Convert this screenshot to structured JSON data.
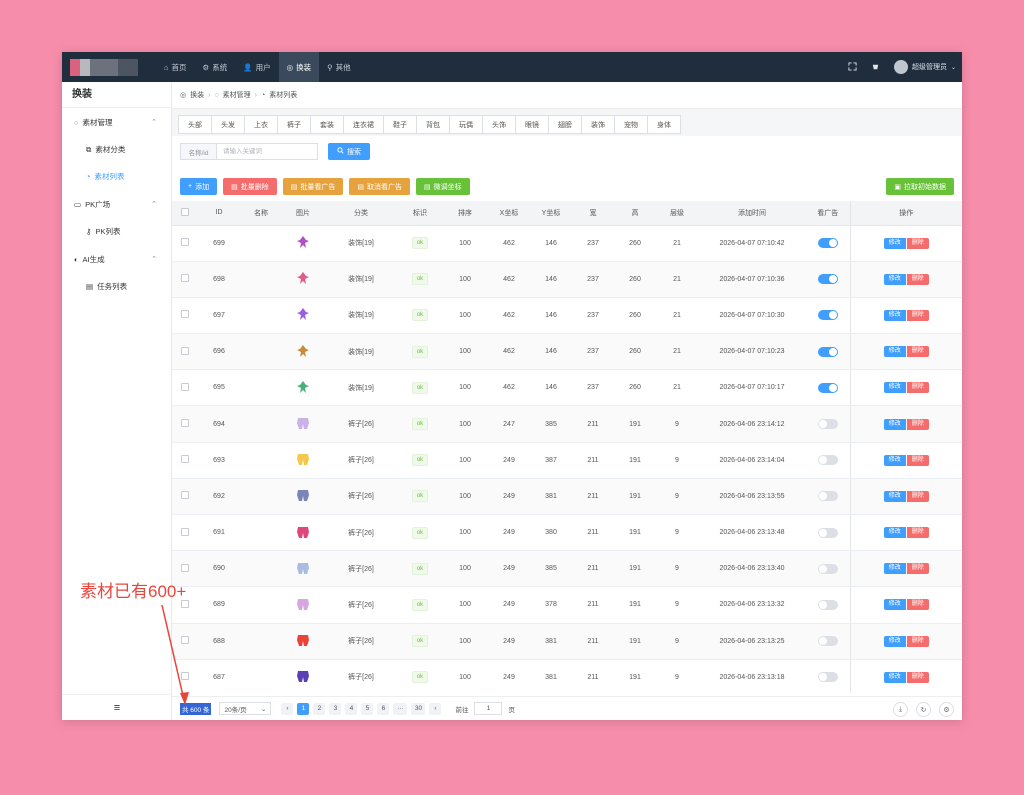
{
  "topbar": {
    "nav": [
      {
        "label": "首页",
        "icon": "home-icon"
      },
      {
        "label": "系统",
        "icon": "gear-icon"
      },
      {
        "label": "用户",
        "icon": "user-icon"
      },
      {
        "label": "换装",
        "icon": "shirt-icon",
        "active": true
      },
      {
        "label": "其他",
        "icon": "pin-icon"
      }
    ],
    "user": "超级管理员"
  },
  "sidebar": {
    "title": "换装",
    "groups": [
      {
        "label": "素材管理",
        "icon": "bulb-icon",
        "children": [
          {
            "label": "素材分类",
            "icon": "category-icon"
          },
          {
            "label": "素材列表",
            "icon": "list-icon",
            "active": true
          }
        ]
      },
      {
        "label": "PK广场",
        "icon": "chat-icon",
        "children": [
          {
            "label": "PK列表",
            "icon": "key-icon"
          }
        ]
      },
      {
        "label": "AI生成",
        "icon": "ai-icon",
        "children": [
          {
            "label": "任务列表",
            "icon": "doc-icon"
          }
        ]
      }
    ]
  },
  "breadcrumb": [
    "换装",
    "素材管理",
    "素材列表"
  ],
  "tabs": [
    "头部",
    "头发",
    "上衣",
    "裤子",
    "套装",
    "连衣裙",
    "鞋子",
    "背包",
    "玩偶",
    "头饰",
    "眼镜",
    "翅膀",
    "装饰",
    "宠物",
    "身体"
  ],
  "search": {
    "label": "名称/id",
    "placeholder": "请输入关键词",
    "button": "搜索"
  },
  "actions": {
    "add": "添加",
    "batch_delete": "批量删除",
    "batch_ad": "批量看广告",
    "cancel_ad": "取消看广告",
    "adjust": "微调坐标",
    "pull": "拉取初始数据"
  },
  "table": {
    "headers": [
      "ID",
      "名称",
      "图片",
      "分类",
      "标识",
      "排序",
      "X坐标",
      "Y坐标",
      "宽",
      "高",
      "层级",
      "添加时间",
      "看广告",
      "操作"
    ],
    "edit_label": "修改",
    "delete_label": "删除",
    "rows": [
      {
        "id": "699",
        "name": "",
        "category": "装饰[19]",
        "tag": "ok",
        "sort": "100",
        "x": "462",
        "y": "146",
        "w": "237",
        "h": "260",
        "level": "21",
        "time": "2026-04-07 07:10:42",
        "ad": true,
        "thumb_color": "#b04fc8"
      },
      {
        "id": "698",
        "name": "",
        "category": "装饰[19]",
        "tag": "ok",
        "sort": "100",
        "x": "462",
        "y": "146",
        "w": "237",
        "h": "260",
        "level": "21",
        "time": "2026-04-07 07:10:36",
        "ad": true,
        "thumb_color": "#e05a8a"
      },
      {
        "id": "697",
        "name": "",
        "category": "装饰[19]",
        "tag": "ok",
        "sort": "100",
        "x": "462",
        "y": "146",
        "w": "237",
        "h": "260",
        "level": "21",
        "time": "2026-04-07 07:10:30",
        "ad": true,
        "thumb_color": "#9b5de5"
      },
      {
        "id": "696",
        "name": "",
        "category": "装饰[19]",
        "tag": "ok",
        "sort": "100",
        "x": "462",
        "y": "146",
        "w": "237",
        "h": "260",
        "level": "21",
        "time": "2026-04-07 07:10:23",
        "ad": true,
        "thumb_color": "#c98a3a"
      },
      {
        "id": "695",
        "name": "",
        "category": "装饰[19]",
        "tag": "ok",
        "sort": "100",
        "x": "462",
        "y": "146",
        "w": "237",
        "h": "260",
        "level": "21",
        "time": "2026-04-07 07:10:17",
        "ad": true,
        "thumb_color": "#4caf7a"
      },
      {
        "id": "694",
        "name": "",
        "category": "裤子[26]",
        "tag": "ok",
        "sort": "100",
        "x": "247",
        "y": "385",
        "w": "211",
        "h": "191",
        "level": "9",
        "time": "2026-04-06 23:14:12",
        "ad": false,
        "thumb_color": "#c9b3e6"
      },
      {
        "id": "693",
        "name": "",
        "category": "裤子[26]",
        "tag": "ok",
        "sort": "100",
        "x": "249",
        "y": "387",
        "w": "211",
        "h": "191",
        "level": "9",
        "time": "2026-04-06 23:14:04",
        "ad": false,
        "thumb_color": "#f2c94c"
      },
      {
        "id": "692",
        "name": "",
        "category": "裤子[26]",
        "tag": "ok",
        "sort": "100",
        "x": "249",
        "y": "381",
        "w": "211",
        "h": "191",
        "level": "9",
        "time": "2026-04-06 23:13:55",
        "ad": false,
        "thumb_color": "#7a86b8"
      },
      {
        "id": "691",
        "name": "",
        "category": "裤子[26]",
        "tag": "ok",
        "sort": "100",
        "x": "249",
        "y": "380",
        "w": "211",
        "h": "191",
        "level": "9",
        "time": "2026-04-06 23:13:48",
        "ad": false,
        "thumb_color": "#e0457b"
      },
      {
        "id": "690",
        "name": "",
        "category": "裤子[26]",
        "tag": "ok",
        "sort": "100",
        "x": "249",
        "y": "385",
        "w": "211",
        "h": "191",
        "level": "9",
        "time": "2026-04-06 23:13:40",
        "ad": false,
        "thumb_color": "#a9bde0"
      },
      {
        "id": "689",
        "name": "",
        "category": "裤子[26]",
        "tag": "ok",
        "sort": "100",
        "x": "249",
        "y": "378",
        "w": "211",
        "h": "191",
        "level": "9",
        "time": "2026-04-06 23:13:32",
        "ad": false,
        "thumb_color": "#d6a6e0"
      },
      {
        "id": "688",
        "name": "",
        "category": "裤子[26]",
        "tag": "ok",
        "sort": "100",
        "x": "249",
        "y": "381",
        "w": "211",
        "h": "191",
        "level": "9",
        "time": "2026-04-06 23:13:25",
        "ad": false,
        "thumb_color": "#e8443a"
      },
      {
        "id": "687",
        "name": "",
        "category": "裤子[26]",
        "tag": "ok",
        "sort": "100",
        "x": "249",
        "y": "381",
        "w": "211",
        "h": "191",
        "level": "9",
        "time": "2026-04-06 23:13:18",
        "ad": false,
        "thumb_color": "#5b3fb5"
      }
    ]
  },
  "pagination": {
    "total": "共 600 条",
    "page_size": "20条/页",
    "pages": [
      "1",
      "2",
      "3",
      "4",
      "5",
      "6",
      "···",
      "30"
    ],
    "goto_prefix": "前往",
    "goto_value": "1",
    "goto_suffix": "页"
  },
  "annotation": "素材已有600+",
  "colors": {
    "accent": "#409eff",
    "danger": "#f56c6c",
    "warning": "#e6a23c",
    "success": "#67c23a",
    "topbar": "#1f2d3d",
    "background": "#f68dab",
    "annotation": "#e8453c"
  }
}
